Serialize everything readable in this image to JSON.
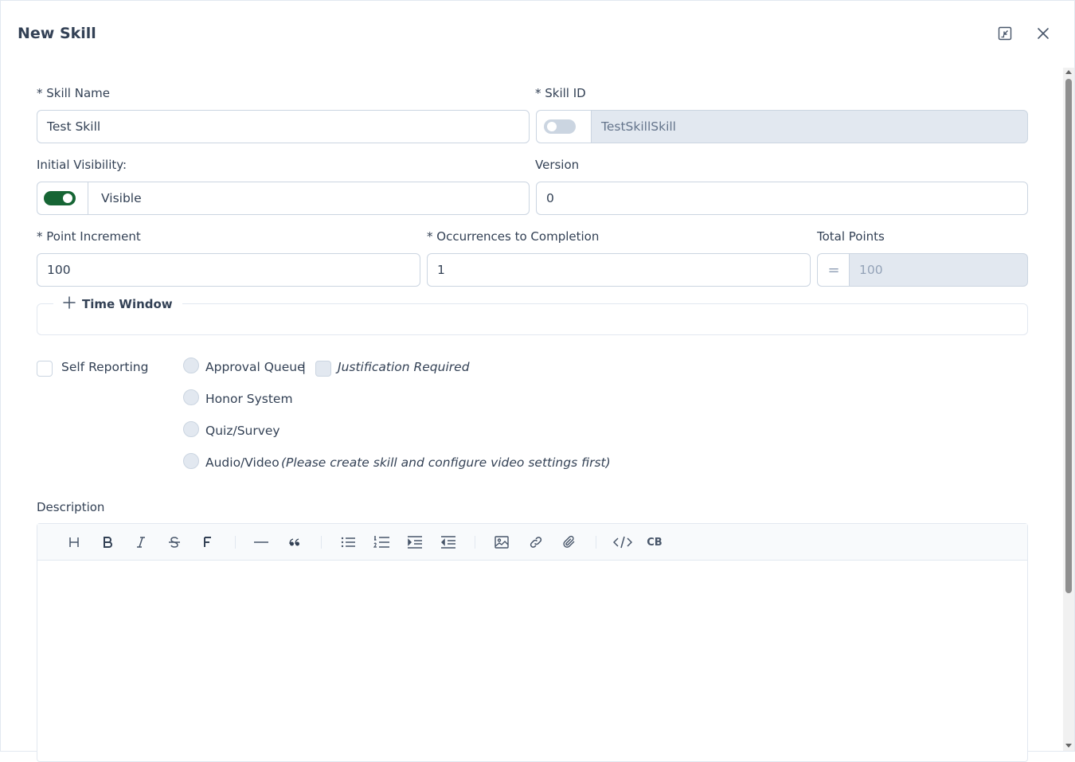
{
  "dialog": {
    "title": "New Skill",
    "minimize_icon": "collapse-icon",
    "close_icon": "close-icon"
  },
  "form": {
    "skill_name": {
      "label": "* Skill Name",
      "value": "Test Skill"
    },
    "skill_id": {
      "label": "* Skill ID",
      "value": "TestSkillSkill",
      "toggle_on": false
    },
    "visibility": {
      "label": "Initial Visibility:",
      "value": "Visible",
      "toggle_on": true
    },
    "version": {
      "label": "Version",
      "value": "0"
    },
    "point_increment": {
      "label": "* Point Increment",
      "value": "100"
    },
    "occurrences": {
      "label": "* Occurrences to Completion",
      "value": "1"
    },
    "total_points": {
      "label": "Total Points",
      "equals": "=",
      "value": "100"
    },
    "time_window": {
      "label": "Time Window"
    },
    "self_reporting": {
      "label": "Self Reporting",
      "separator": "|",
      "options": [
        {
          "label": "Approval Queue"
        },
        {
          "label": "Honor System"
        },
        {
          "label": "Quiz/Survey"
        },
        {
          "label": "Audio/Video",
          "note": "(Please create skill and configure video settings first)"
        }
      ],
      "justification_label": "Justification Required"
    },
    "description": {
      "label": "Description",
      "toolbar": [
        "heading-icon",
        "bold-icon",
        "italic-icon",
        "strikethrough-icon",
        "font-icon",
        "horizontal-rule-icon",
        "quote-icon",
        "bullet-list-icon",
        "ordered-list-icon",
        "indent-icon",
        "outdent-icon",
        "image-icon",
        "link-icon",
        "attachment-icon",
        "code-icon",
        "code-block-icon"
      ],
      "codeblock_label": "CB"
    }
  },
  "colors": {
    "toggle_on": "#166534",
    "toggle_off": "#cbd5e1",
    "disabled_bg": "#e2e8f0"
  }
}
